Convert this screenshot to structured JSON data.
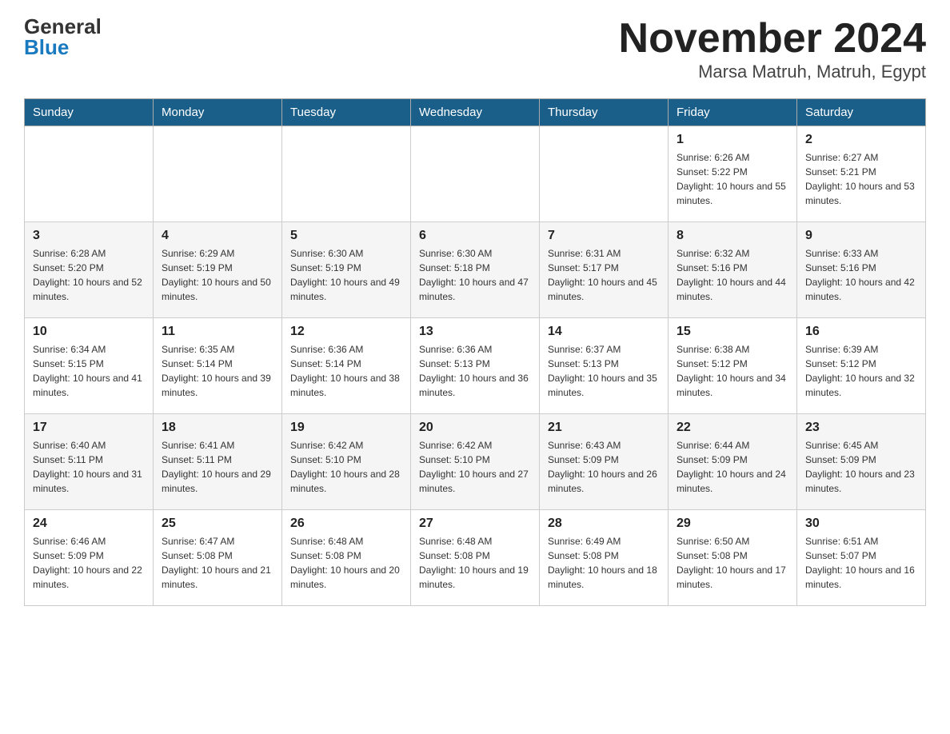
{
  "header": {
    "logo_general": "General",
    "logo_blue": "Blue",
    "title": "November 2024",
    "subtitle": "Marsa Matruh, Matruh, Egypt"
  },
  "days_of_week": [
    "Sunday",
    "Monday",
    "Tuesday",
    "Wednesday",
    "Thursday",
    "Friday",
    "Saturday"
  ],
  "weeks": [
    {
      "days": [
        {
          "date": "",
          "info": ""
        },
        {
          "date": "",
          "info": ""
        },
        {
          "date": "",
          "info": ""
        },
        {
          "date": "",
          "info": ""
        },
        {
          "date": "",
          "info": ""
        },
        {
          "date": "1",
          "info": "Sunrise: 6:26 AM\nSunset: 5:22 PM\nDaylight: 10 hours and 55 minutes."
        },
        {
          "date": "2",
          "info": "Sunrise: 6:27 AM\nSunset: 5:21 PM\nDaylight: 10 hours and 53 minutes."
        }
      ]
    },
    {
      "days": [
        {
          "date": "3",
          "info": "Sunrise: 6:28 AM\nSunset: 5:20 PM\nDaylight: 10 hours and 52 minutes."
        },
        {
          "date": "4",
          "info": "Sunrise: 6:29 AM\nSunset: 5:19 PM\nDaylight: 10 hours and 50 minutes."
        },
        {
          "date": "5",
          "info": "Sunrise: 6:30 AM\nSunset: 5:19 PM\nDaylight: 10 hours and 49 minutes."
        },
        {
          "date": "6",
          "info": "Sunrise: 6:30 AM\nSunset: 5:18 PM\nDaylight: 10 hours and 47 minutes."
        },
        {
          "date": "7",
          "info": "Sunrise: 6:31 AM\nSunset: 5:17 PM\nDaylight: 10 hours and 45 minutes."
        },
        {
          "date": "8",
          "info": "Sunrise: 6:32 AM\nSunset: 5:16 PM\nDaylight: 10 hours and 44 minutes."
        },
        {
          "date": "9",
          "info": "Sunrise: 6:33 AM\nSunset: 5:16 PM\nDaylight: 10 hours and 42 minutes."
        }
      ]
    },
    {
      "days": [
        {
          "date": "10",
          "info": "Sunrise: 6:34 AM\nSunset: 5:15 PM\nDaylight: 10 hours and 41 minutes."
        },
        {
          "date": "11",
          "info": "Sunrise: 6:35 AM\nSunset: 5:14 PM\nDaylight: 10 hours and 39 minutes."
        },
        {
          "date": "12",
          "info": "Sunrise: 6:36 AM\nSunset: 5:14 PM\nDaylight: 10 hours and 38 minutes."
        },
        {
          "date": "13",
          "info": "Sunrise: 6:36 AM\nSunset: 5:13 PM\nDaylight: 10 hours and 36 minutes."
        },
        {
          "date": "14",
          "info": "Sunrise: 6:37 AM\nSunset: 5:13 PM\nDaylight: 10 hours and 35 minutes."
        },
        {
          "date": "15",
          "info": "Sunrise: 6:38 AM\nSunset: 5:12 PM\nDaylight: 10 hours and 34 minutes."
        },
        {
          "date": "16",
          "info": "Sunrise: 6:39 AM\nSunset: 5:12 PM\nDaylight: 10 hours and 32 minutes."
        }
      ]
    },
    {
      "days": [
        {
          "date": "17",
          "info": "Sunrise: 6:40 AM\nSunset: 5:11 PM\nDaylight: 10 hours and 31 minutes."
        },
        {
          "date": "18",
          "info": "Sunrise: 6:41 AM\nSunset: 5:11 PM\nDaylight: 10 hours and 29 minutes."
        },
        {
          "date": "19",
          "info": "Sunrise: 6:42 AM\nSunset: 5:10 PM\nDaylight: 10 hours and 28 minutes."
        },
        {
          "date": "20",
          "info": "Sunrise: 6:42 AM\nSunset: 5:10 PM\nDaylight: 10 hours and 27 minutes."
        },
        {
          "date": "21",
          "info": "Sunrise: 6:43 AM\nSunset: 5:09 PM\nDaylight: 10 hours and 26 minutes."
        },
        {
          "date": "22",
          "info": "Sunrise: 6:44 AM\nSunset: 5:09 PM\nDaylight: 10 hours and 24 minutes."
        },
        {
          "date": "23",
          "info": "Sunrise: 6:45 AM\nSunset: 5:09 PM\nDaylight: 10 hours and 23 minutes."
        }
      ]
    },
    {
      "days": [
        {
          "date": "24",
          "info": "Sunrise: 6:46 AM\nSunset: 5:09 PM\nDaylight: 10 hours and 22 minutes."
        },
        {
          "date": "25",
          "info": "Sunrise: 6:47 AM\nSunset: 5:08 PM\nDaylight: 10 hours and 21 minutes."
        },
        {
          "date": "26",
          "info": "Sunrise: 6:48 AM\nSunset: 5:08 PM\nDaylight: 10 hours and 20 minutes."
        },
        {
          "date": "27",
          "info": "Sunrise: 6:48 AM\nSunset: 5:08 PM\nDaylight: 10 hours and 19 minutes."
        },
        {
          "date": "28",
          "info": "Sunrise: 6:49 AM\nSunset: 5:08 PM\nDaylight: 10 hours and 18 minutes."
        },
        {
          "date": "29",
          "info": "Sunrise: 6:50 AM\nSunset: 5:08 PM\nDaylight: 10 hours and 17 minutes."
        },
        {
          "date": "30",
          "info": "Sunrise: 6:51 AM\nSunset: 5:07 PM\nDaylight: 10 hours and 16 minutes."
        }
      ]
    }
  ]
}
